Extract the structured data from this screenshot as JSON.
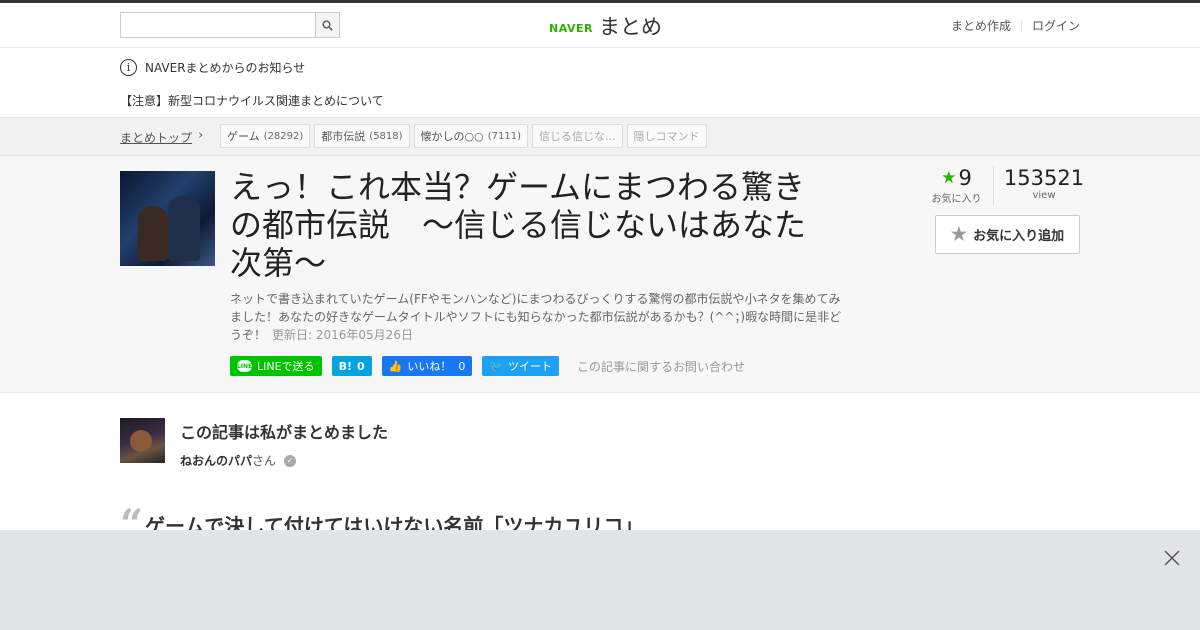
{
  "header": {
    "search": {
      "placeholder": "",
      "value": ""
    },
    "logo": {
      "brand": "NAVER",
      "product": "まとめ"
    },
    "links": [
      {
        "label": "まとめ作成"
      },
      {
        "label": "ログイン"
      }
    ]
  },
  "notice": {
    "heading": "NAVERまとめからのお知らせ",
    "link": "【注意】新型コロナウイルス関連まとめについて"
  },
  "breadcrumb": {
    "home": "まとめトップ",
    "tags": [
      {
        "label": "ゲーム",
        "count": "(28292)"
      },
      {
        "label": "都市伝説",
        "count": "(5818)"
      },
      {
        "label": "懐かしの○○",
        "count": "(7111)"
      },
      {
        "label": "信じる信じな...",
        "count": ""
      },
      {
        "label": "隠しコマンド",
        "count": ""
      }
    ]
  },
  "article": {
    "title": "えっ！これ本当？ゲームにまつわる驚きの都市伝説　～信じる信じないはあなた次第～",
    "description": "ネットで書き込まれていたゲーム(FFやモンハンなど)にまつわるびっくりする驚愕の都市伝説や小ネタを集めてみました！あなたの好きなゲームタイトルやソフトにも知らなかった都市伝説があるかも？(^^；)暇な時間に是非どうぞ！",
    "updated": "更新日: 2016年05月26日",
    "stats": {
      "favorites": "9",
      "favorites_label": "お気に入り",
      "views": "153521",
      "views_label": "view"
    },
    "fav_button": "お気に入り追加",
    "social": {
      "line": "LINEで送る",
      "hatena_count": "0",
      "fb_label": "いいね！",
      "fb_count": "0",
      "tweet": "ツイート",
      "contact": "この記事に関するお問い合わせ"
    }
  },
  "author": {
    "heading": "この記事は私がまとめました",
    "name": "ねおんのパパ",
    "suffix": "さん"
  },
  "section": {
    "heading": "ゲームで決して付けてはいけない名前「ツナカユリコ」"
  }
}
